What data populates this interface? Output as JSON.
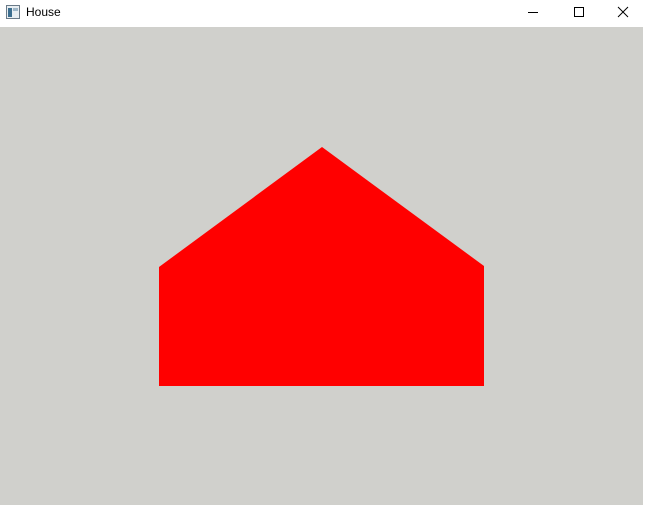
{
  "window": {
    "title": "House"
  },
  "title_controls": {
    "minimize_icon": "minimize-icon",
    "maximize_icon": "maximize-icon",
    "close_icon": "close-icon"
  },
  "canvas": {
    "background_color": "#d0d0cc",
    "shape": {
      "name": "house",
      "fill_color": "#ff0000"
    }
  }
}
